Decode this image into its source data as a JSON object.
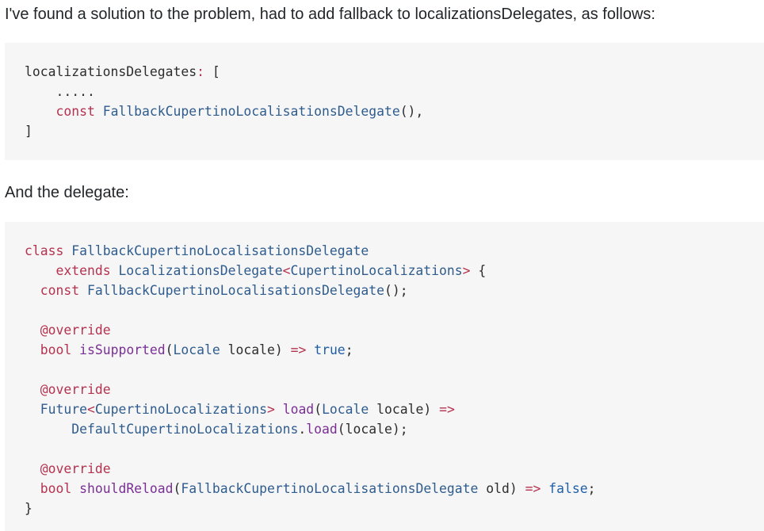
{
  "answer": {
    "intro_text": "I've found a solution to the problem, had to add fallback to localizationsDelegates, as follows:",
    "delegate_text": "And the delegate:"
  },
  "snippet1": {
    "lines": [
      [
        {
          "t": "localizationsDelegates",
          "c": "p"
        },
        {
          "t": ": ",
          "c": "k"
        },
        {
          "t": "[",
          "c": "p"
        }
      ],
      [
        {
          "t": "    .....",
          "c": "p"
        }
      ],
      [
        {
          "t": "    ",
          "c": "p"
        },
        {
          "t": "const",
          "c": "k"
        },
        {
          "t": " ",
          "c": "p"
        },
        {
          "t": "FallbackCupertinoLocalisationsDelegate",
          "c": "t"
        },
        {
          "t": "(),",
          "c": "p"
        }
      ],
      [
        {
          "t": "]",
          "c": "p"
        }
      ]
    ]
  },
  "snippet2": {
    "lines": [
      [
        {
          "t": "class",
          "c": "k"
        },
        {
          "t": " ",
          "c": "p"
        },
        {
          "t": "FallbackCupertinoLocalisationsDelegate",
          "c": "t"
        }
      ],
      [
        {
          "t": "    ",
          "c": "p"
        },
        {
          "t": "extends",
          "c": "k"
        },
        {
          "t": " ",
          "c": "p"
        },
        {
          "t": "LocalizationsDelegate",
          "c": "t"
        },
        {
          "t": "<",
          "c": "k"
        },
        {
          "t": "CupertinoLocalizations",
          "c": "t"
        },
        {
          "t": ">",
          "c": "k"
        },
        {
          "t": " {",
          "c": "p"
        }
      ],
      [
        {
          "t": "  ",
          "c": "p"
        },
        {
          "t": "const",
          "c": "k"
        },
        {
          "t": " ",
          "c": "p"
        },
        {
          "t": "FallbackCupertinoLocalisationsDelegate",
          "c": "t"
        },
        {
          "t": "();",
          "c": "p"
        }
      ],
      [
        {
          "t": "",
          "c": "p"
        }
      ],
      [
        {
          "t": "  ",
          "c": "p"
        },
        {
          "t": "@override",
          "c": "k"
        }
      ],
      [
        {
          "t": "  ",
          "c": "p"
        },
        {
          "t": "bool",
          "c": "k"
        },
        {
          "t": " ",
          "c": "p"
        },
        {
          "t": "isSupported",
          "c": "f"
        },
        {
          "t": "(",
          "c": "p"
        },
        {
          "t": "Locale",
          "c": "t"
        },
        {
          "t": " locale) ",
          "c": "p"
        },
        {
          "t": "=>",
          "c": "k"
        },
        {
          "t": " ",
          "c": "p"
        },
        {
          "t": "true",
          "c": "lit"
        },
        {
          "t": ";",
          "c": "p"
        }
      ],
      [
        {
          "t": "",
          "c": "p"
        }
      ],
      [
        {
          "t": "  ",
          "c": "p"
        },
        {
          "t": "@override",
          "c": "k"
        }
      ],
      [
        {
          "t": "  ",
          "c": "p"
        },
        {
          "t": "Future",
          "c": "t"
        },
        {
          "t": "<",
          "c": "k"
        },
        {
          "t": "CupertinoLocalizations",
          "c": "t"
        },
        {
          "t": ">",
          "c": "k"
        },
        {
          "t": " ",
          "c": "p"
        },
        {
          "t": "load",
          "c": "f"
        },
        {
          "t": "(",
          "c": "p"
        },
        {
          "t": "Locale",
          "c": "t"
        },
        {
          "t": " locale) ",
          "c": "p"
        },
        {
          "t": "=>",
          "c": "k"
        }
      ],
      [
        {
          "t": "      ",
          "c": "p"
        },
        {
          "t": "DefaultCupertinoLocalizations",
          "c": "t"
        },
        {
          "t": ".",
          "c": "p"
        },
        {
          "t": "load",
          "c": "f"
        },
        {
          "t": "(locale);",
          "c": "p"
        }
      ],
      [
        {
          "t": "",
          "c": "p"
        }
      ],
      [
        {
          "t": "  ",
          "c": "p"
        },
        {
          "t": "@override",
          "c": "k"
        }
      ],
      [
        {
          "t": "  ",
          "c": "p"
        },
        {
          "t": "bool",
          "c": "k"
        },
        {
          "t": " ",
          "c": "p"
        },
        {
          "t": "shouldReload",
          "c": "f"
        },
        {
          "t": "(",
          "c": "p"
        },
        {
          "t": "FallbackCupertinoLocalisationsDelegate",
          "c": "t"
        },
        {
          "t": " old) ",
          "c": "p"
        },
        {
          "t": "=>",
          "c": "k"
        },
        {
          "t": " ",
          "c": "p"
        },
        {
          "t": "false",
          "c": "lit"
        },
        {
          "t": ";",
          "c": "p"
        }
      ],
      [
        {
          "t": "}",
          "c": "p"
        }
      ]
    ]
  },
  "colors": {
    "keyword": "#b5324f",
    "type": "#2f5c8e",
    "method": "#7a2f94",
    "literal": "#1f5fa8",
    "code_background": "#f6f6f6"
  }
}
